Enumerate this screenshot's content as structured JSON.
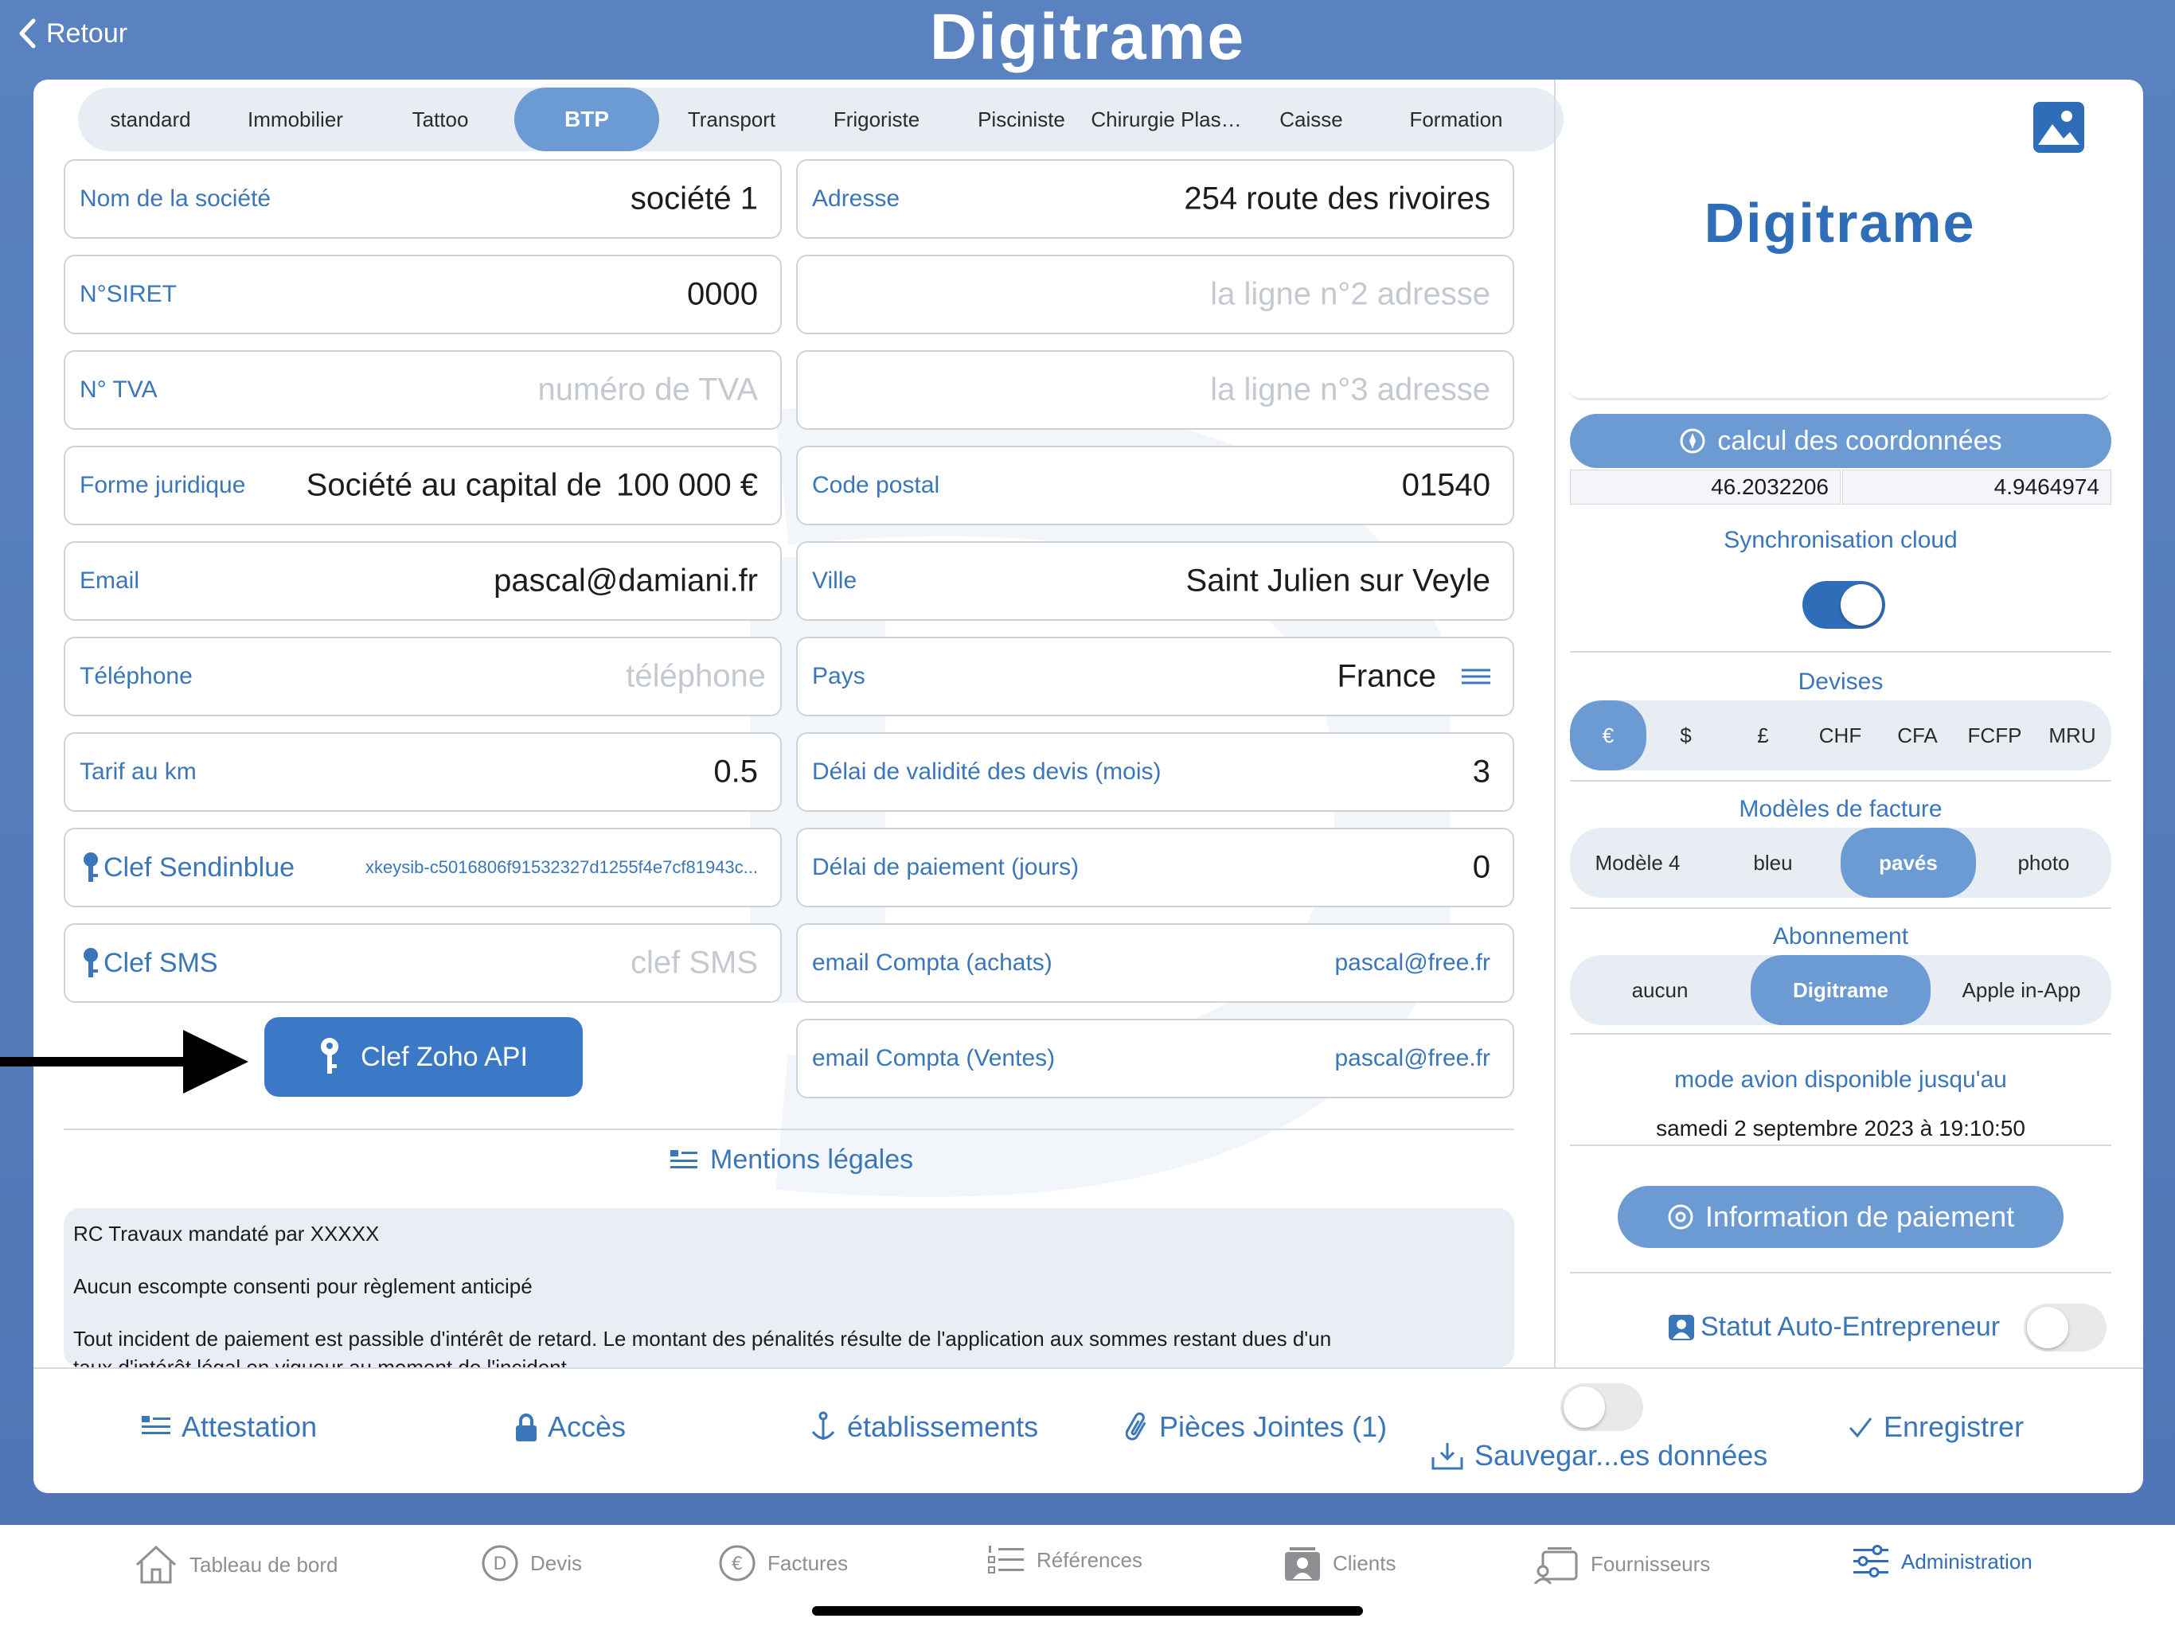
{
  "header": {
    "back": "Retour",
    "logo": "Digitrame"
  },
  "profiles": {
    "items": [
      "standard",
      "Immobilier",
      "Tattoo",
      "BTP",
      "Transport",
      "Frigoriste",
      "Pisciniste",
      "Chirurgie Plas…",
      "Caisse",
      "Formation"
    ],
    "selected": "BTP"
  },
  "left": {
    "company_label": "Nom de la société",
    "company_value": "société 1",
    "siret_label": "N°SIRET",
    "siret_value": "0000",
    "tva_label": "N° TVA",
    "tva_placeholder": "numéro de TVA",
    "legal_label": "Forme juridique",
    "legal_value": "Société au capital de",
    "capital_value": "100 000 €",
    "email_label": "Email",
    "email_value": "pascal@damiani.fr",
    "phone_label": "Téléphone",
    "phone_placeholder": "téléphone",
    "km_label": "Tarif au km",
    "km_value": "0.5",
    "sendinblue_label": "Clef Sendinblue",
    "sendinblue_value": "xkeysib-c5016806f91532327d1255f4e7cf81943c...",
    "sms_label": "Clef SMS",
    "sms_placeholder": "clef SMS",
    "zoho_button": "Clef Zoho API"
  },
  "right": {
    "address_label": "Adresse",
    "address_value": "254 route des rivoires",
    "address2_placeholder": "la ligne n°2 adresse",
    "address3_placeholder": "la ligne n°3 adresse",
    "postal_label": "Code postal",
    "postal_value": "01540",
    "city_label": "Ville",
    "city_value": "Saint Julien sur Veyle",
    "country_label": "Pays",
    "country_value": "France",
    "quote_label": "Délai de validité des devis (mois)",
    "quote_value": "3",
    "payment_label": "Délai de paiement (jours)",
    "payment_value": "0",
    "buy_label": "email Compta (achats)",
    "buy_value": "pascal@free.fr",
    "sales_label": "email Compta (Ventes)",
    "sales_value": "pascal@free.fr"
  },
  "mentions": {
    "title": "Mentions légales",
    "lines": [
      "RC Travaux mandaté par XXXXX",
      "Aucun escompte consenti pour règlement anticipé",
      "Tout incident de paiement est passible d'intérêt de retard. Le montant des pénalités résulte de l'application aux sommes restant dues d'un",
      "taux d'intérêt légal en vigueur au moment de l'incident."
    ]
  },
  "side": {
    "logo": "Digitrame",
    "coords_button": "calcul des coordonnées",
    "lat": "46.2032206",
    "lon": "4.9464974",
    "cloud_label": "Synchronisation cloud",
    "cloud_on": true,
    "currencies_label": "Devises",
    "currencies": [
      "€",
      "$",
      "£",
      "CHF",
      "CFA",
      "FCFP",
      "MRU"
    ],
    "currency_selected": "€",
    "templates_label": "Modèles de facture",
    "templates": [
      "Modèle 4",
      "bleu",
      "pavés",
      "photo"
    ],
    "template_selected": "pavés",
    "subscription_label": "Abonnement",
    "subscriptions": [
      "aucun",
      "Digitrame",
      "Apple in-App"
    ],
    "subscription_selected": "Digitrame",
    "airplane_label": "mode avion disponible jusqu'au",
    "airplane_date": "samedi 2 septembre 2023 à 19:10:50",
    "payment_info_button": "Information de paiement",
    "auto_entrepreneur_label": "Statut Auto-Entrepreneur",
    "auto_entrepreneur_on": false
  },
  "toolbar": {
    "attestation": "Attestation",
    "acces": "Accès",
    "etablissements": "établissements",
    "pieces": "Pièces Jointes (1)",
    "sauvegarde": "Sauvegar...es données",
    "enregistrer": "Enregistrer"
  },
  "tabs": {
    "items": [
      "Tableau de bord",
      "Devis",
      "Factures",
      "Références",
      "Clients",
      "Fournisseurs",
      "Administration"
    ],
    "active": "Administration"
  },
  "colors": {
    "accent": "#3a76b9",
    "selected": "#6c9ad2",
    "toggle_on": "#2f6db8",
    "header_bg": "#5b82c0"
  }
}
